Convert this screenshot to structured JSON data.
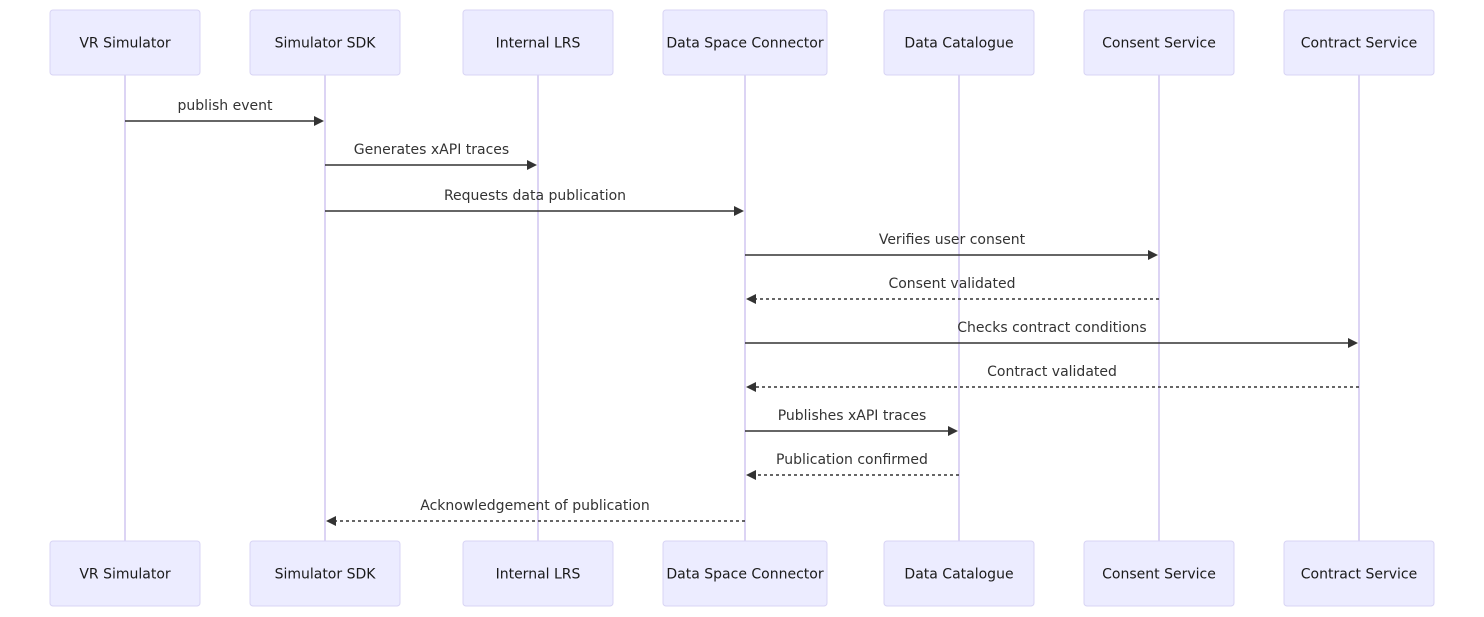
{
  "diagram": {
    "type": "sequence",
    "participants": [
      {
        "id": "vr",
        "label": "VR Simulator"
      },
      {
        "id": "sdk",
        "label": "Simulator SDK"
      },
      {
        "id": "lrs",
        "label": "Internal LRS"
      },
      {
        "id": "dsc",
        "label": "Data Space Connector"
      },
      {
        "id": "cat",
        "label": "Data Catalogue"
      },
      {
        "id": "cons",
        "label": "Consent Service"
      },
      {
        "id": "contr",
        "label": "Contract Service"
      }
    ],
    "messages": [
      {
        "from": "vr",
        "to": "sdk",
        "label": "publish event",
        "style": "solid"
      },
      {
        "from": "sdk",
        "to": "lrs",
        "label": "Generates xAPI traces",
        "style": "solid"
      },
      {
        "from": "sdk",
        "to": "dsc",
        "label": "Requests data publication",
        "style": "solid"
      },
      {
        "from": "dsc",
        "to": "cons",
        "label": "Verifies user consent",
        "style": "solid"
      },
      {
        "from": "cons",
        "to": "dsc",
        "label": "Consent validated",
        "style": "dashed"
      },
      {
        "from": "dsc",
        "to": "contr",
        "label": "Checks contract conditions",
        "style": "solid"
      },
      {
        "from": "contr",
        "to": "dsc",
        "label": "Contract validated",
        "style": "dashed"
      },
      {
        "from": "dsc",
        "to": "cat",
        "label": "Publishes xAPI traces",
        "style": "solid"
      },
      {
        "from": "cat",
        "to": "dsc",
        "label": "Publication confirmed",
        "style": "dashed"
      },
      {
        "from": "dsc",
        "to": "sdk",
        "label": "Acknowledgement of publication",
        "style": "dashed"
      }
    ]
  },
  "colors": {
    "actor_fill": "#ececff",
    "actor_border": "#d8d4f4",
    "lifeline": "#d1c6f0",
    "message": "#333333"
  }
}
